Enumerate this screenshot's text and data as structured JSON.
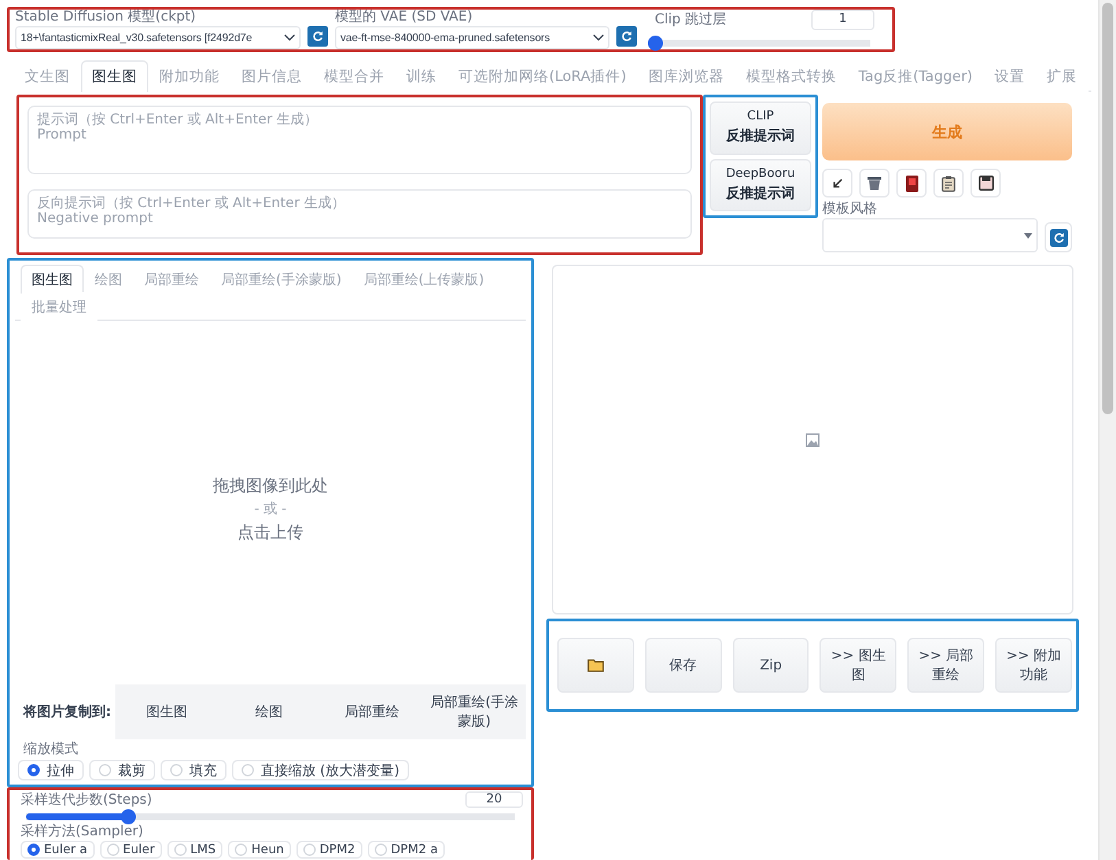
{
  "model_bar": {
    "checkpoint": {
      "label": "Stable Diffusion 模型(ckpt)",
      "value": "18+\\fantasticmixReal_v30.safetensors [f2492d7e"
    },
    "vae": {
      "label": "模型的 VAE (SD VAE)",
      "value": "vae-ft-mse-840000-ema-pruned.safetensors"
    },
    "clip_skip": {
      "label": "Clip 跳过层",
      "value": "1",
      "level": 0
    }
  },
  "tabs": [
    {
      "label": "文生图",
      "selected": false
    },
    {
      "label": "图生图",
      "selected": true
    },
    {
      "label": "附加功能",
      "selected": false
    },
    {
      "label": "图片信息",
      "selected": false
    },
    {
      "label": "模型合并",
      "selected": false
    },
    {
      "label": "训练",
      "selected": false
    },
    {
      "label": "可选附加网络(LoRA插件)",
      "selected": false
    },
    {
      "label": "图库浏览器",
      "selected": false
    },
    {
      "label": "模型格式转换",
      "selected": false
    },
    {
      "label": "Tag反推(Tagger)",
      "selected": false
    },
    {
      "label": "设置",
      "selected": false
    },
    {
      "label": "扩展",
      "selected": false
    }
  ],
  "prompts": [
    {
      "placeholder": "提示词（按 Ctrl+Enter 或 Alt+Enter 生成）\nPrompt"
    },
    {
      "placeholder": "反向提示词（按 Ctrl+Enter 或 Alt+Enter 生成）\nNegative prompt"
    }
  ],
  "interrogate_buttons": [
    {
      "line_1": "CLIP",
      "line_2": "反推提示词"
    },
    {
      "line_1": "DeepBooru",
      "line_2": "反推提示词"
    }
  ],
  "generate_button": "生成",
  "tool_buttons": [
    {
      "kind": "arrow"
    },
    {
      "kind": "trash"
    },
    {
      "kind": "card"
    },
    {
      "kind": "clipboard"
    },
    {
      "kind": "save"
    }
  ],
  "style": {
    "label": "模板风格"
  },
  "image_tabs": [
    {
      "label": "图生图",
      "selected": true
    },
    {
      "label": "绘图",
      "selected": false
    },
    {
      "label": "局部重绘",
      "selected": false
    },
    {
      "label": "局部重绘(手涂蒙版)",
      "selected": false
    },
    {
      "label": "局部重绘(上传蒙版)",
      "selected": false
    },
    {
      "label": "批量处理",
      "selected": false
    }
  ],
  "upload": {
    "title": "拖拽图像到此处",
    "separator": "- 或 -",
    "action": "点击上传"
  },
  "copy_to": {
    "label": "将图片复制到:",
    "buttons": [
      "图生图",
      "绘图",
      "局部重绘",
      "局部重绘(手涂蒙版)"
    ]
  },
  "resize_mode": {
    "label": "缩放模式",
    "options": [
      {
        "label": "拉伸",
        "selected": true
      },
      {
        "label": "裁剪",
        "selected": false
      },
      {
        "label": "填充",
        "selected": false
      },
      {
        "label": "直接缩放 (放大潜变量)",
        "selected": false
      }
    ]
  },
  "steps": {
    "label": "采样迭代步数(Steps)",
    "value": "20",
    "level": 0.2
  },
  "sampler": {
    "label": "采样方法(Sampler)",
    "options": [
      {
        "label": "Euler a",
        "selected": true
      },
      {
        "label": "Euler",
        "selected": false
      },
      {
        "label": "LMS",
        "selected": false
      },
      {
        "label": "Heun",
        "selected": false
      },
      {
        "label": "DPM2",
        "selected": false
      },
      {
        "label": "DPM2 a",
        "selected": false
      }
    ]
  },
  "output_buttons": [
    {
      "kind": "folder"
    },
    {
      "kind": "text",
      "label": "保存"
    },
    {
      "kind": "text",
      "label": "Zip"
    },
    {
      "kind": "text",
      "label": ">> 图生图"
    },
    {
      "kind": "text",
      "label": ">> 局部重绘"
    },
    {
      "kind": "text",
      "label": ">> 附加功能"
    }
  ]
}
